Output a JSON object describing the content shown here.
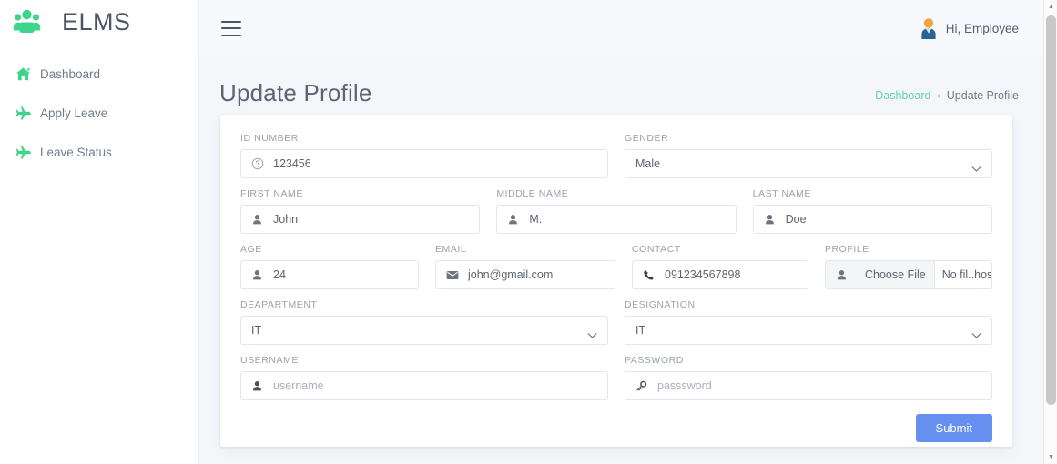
{
  "sidebar": {
    "brand": {
      "name": "ELMS",
      "icon": "users-group-icon",
      "color": "#3ed48c"
    },
    "items": [
      {
        "label": "Dashboard",
        "icon": "home-icon"
      },
      {
        "label": "Apply Leave",
        "icon": "plane-icon"
      },
      {
        "label": "Leave Status",
        "icon": "plane-icon"
      }
    ]
  },
  "topbar": {
    "menu_icon": "hamburger-icon",
    "avatar_icon": "user-avatar-icon",
    "greeting": "Hi, Employee"
  },
  "page": {
    "title": "Update Profile",
    "breadcrumb": {
      "root": "Dashboard",
      "separator": "›",
      "current": "Update Profile"
    }
  },
  "form": {
    "id_number": {
      "label": "ID NUMBER",
      "value": "123456",
      "icon": "question-circle-icon"
    },
    "gender": {
      "label": "GENDER",
      "value": "Male",
      "icon": "chevron-down-icon"
    },
    "first_name": {
      "label": "FIRST NAME",
      "value": "John",
      "icon": "user-icon"
    },
    "middle_name": {
      "label": "MIDDLE NAME",
      "value": "M.",
      "icon": "user-icon"
    },
    "last_name": {
      "label": "LAST NAME",
      "value": "Doe",
      "icon": "user-icon"
    },
    "age": {
      "label": "AGE",
      "value": "24",
      "icon": "user-icon"
    },
    "email": {
      "label": "EMAIL",
      "value": "john@gmail.com",
      "icon": "envelope-icon"
    },
    "contact": {
      "label": "CONTACT",
      "value": "091234567898",
      "icon": "phone-icon"
    },
    "profile": {
      "label": "PROFILE",
      "button": "Choose File",
      "status": "No fil..hosen",
      "icon": "user-icon"
    },
    "department": {
      "label": "DEAPARTMENT",
      "value": "IT",
      "icon": "chevron-down-icon"
    },
    "designation": {
      "label": "DESIGNATION",
      "value": "IT",
      "icon": "chevron-down-icon"
    },
    "username": {
      "label": "USERNAME",
      "value": "",
      "placeholder": "username",
      "icon": "user-icon"
    },
    "password": {
      "label": "PASSWORD",
      "value": "",
      "placeholder": "passsword",
      "icon": "key-icon"
    },
    "submit": {
      "label": "Submit",
      "color": "#6690f0"
    }
  },
  "colors": {
    "brand_green": "#3ed48b",
    "accent_blue": "#6690f0",
    "page_bg": "#f4f6fa",
    "text_muted": "#9aa1ad"
  }
}
